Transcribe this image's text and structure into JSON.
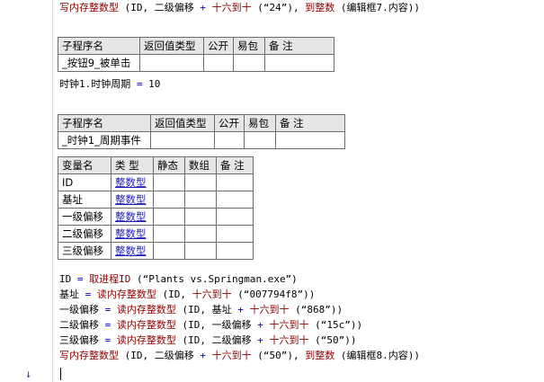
{
  "code_lines": {
    "l0": [
      [
        "kw",
        "写内存整数型"
      ],
      [
        "plain",
        " (ID, 二级偏移 "
      ],
      [
        "op",
        "+"
      ],
      [
        "kw",
        " 十六到十"
      ],
      [
        "plain",
        " (“24”), "
      ],
      [
        "kw",
        "到整数"
      ],
      [
        "plain",
        " (编辑框7.内容))"
      ]
    ],
    "l1": [
      [
        "plain",
        "时钟1.时钟周期 "
      ],
      [
        "op",
        "="
      ],
      [
        "plain",
        " 10"
      ]
    ],
    "l2": [
      [
        "plain",
        "ID "
      ],
      [
        "op",
        "="
      ],
      [
        "kw",
        " 取进程ID"
      ],
      [
        "plain",
        " (“Plants vs.Springman.exe”)"
      ]
    ],
    "l3": [
      [
        "plain",
        "基址 "
      ],
      [
        "op",
        "="
      ],
      [
        "kw",
        " 读内存整数型"
      ],
      [
        "plain",
        " (ID, "
      ],
      [
        "kw",
        "十六到十"
      ],
      [
        "plain",
        " (“007794f8”))"
      ]
    ],
    "l4": [
      [
        "plain",
        "一级偏移 "
      ],
      [
        "op",
        "="
      ],
      [
        "kw",
        " 读内存整数型"
      ],
      [
        "plain",
        " (ID, 基址 "
      ],
      [
        "op",
        "+"
      ],
      [
        "kw",
        " 十六到十"
      ],
      [
        "plain",
        " (“868”))"
      ]
    ],
    "l5": [
      [
        "plain",
        "二级偏移 "
      ],
      [
        "op",
        "="
      ],
      [
        "kw",
        " 读内存整数型"
      ],
      [
        "plain",
        " (ID, 一级偏移 "
      ],
      [
        "op",
        "+"
      ],
      [
        "kw",
        " 十六到十"
      ],
      [
        "plain",
        " (“15c”))"
      ]
    ],
    "l6": [
      [
        "plain",
        "三级偏移 "
      ],
      [
        "op",
        "="
      ],
      [
        "kw",
        " 读内存整数型"
      ],
      [
        "plain",
        " (ID, 二级偏移 "
      ],
      [
        "op",
        "+"
      ],
      [
        "kw",
        " 十六到十"
      ],
      [
        "plain",
        " (“50”))"
      ]
    ],
    "l7": [
      [
        "kw",
        "写内存整数型"
      ],
      [
        "plain",
        " (ID, 二级偏移 "
      ],
      [
        "op",
        "+"
      ],
      [
        "kw",
        " 十六到十"
      ],
      [
        "plain",
        " (“50”), "
      ],
      [
        "kw",
        "到整数"
      ],
      [
        "plain",
        " (编辑框8.内容))"
      ]
    ]
  },
  "sub1": {
    "headers": [
      "子程序名",
      "返回值类型",
      "公开",
      "易包",
      "备 注"
    ],
    "name": "_按钮9_被单击"
  },
  "sub2": {
    "headers": [
      "子程序名",
      "返回值类型",
      "公开",
      "易包",
      "备 注"
    ],
    "name": "_时钟1_周期事件"
  },
  "vars": {
    "headers": [
      "变量名",
      "类 型",
      "静态",
      "数组",
      "备 注"
    ],
    "rows": [
      {
        "name": "ID",
        "type": "整数型"
      },
      {
        "name": "基址",
        "type": "整数型"
      },
      {
        "name": "一级偏移",
        "type": "整数型"
      },
      {
        "name": "二级偏移",
        "type": "整数型"
      },
      {
        "name": "三级偏移",
        "type": "整数型"
      }
    ]
  },
  "gutter": {
    "arrow_icon": "down-arrow-icon"
  },
  "colors": {
    "keyword": "#8b0000",
    "operator": "#0000c8",
    "type_link": "#1f1fc0",
    "table_header_bg": "#e6e6e6"
  }
}
